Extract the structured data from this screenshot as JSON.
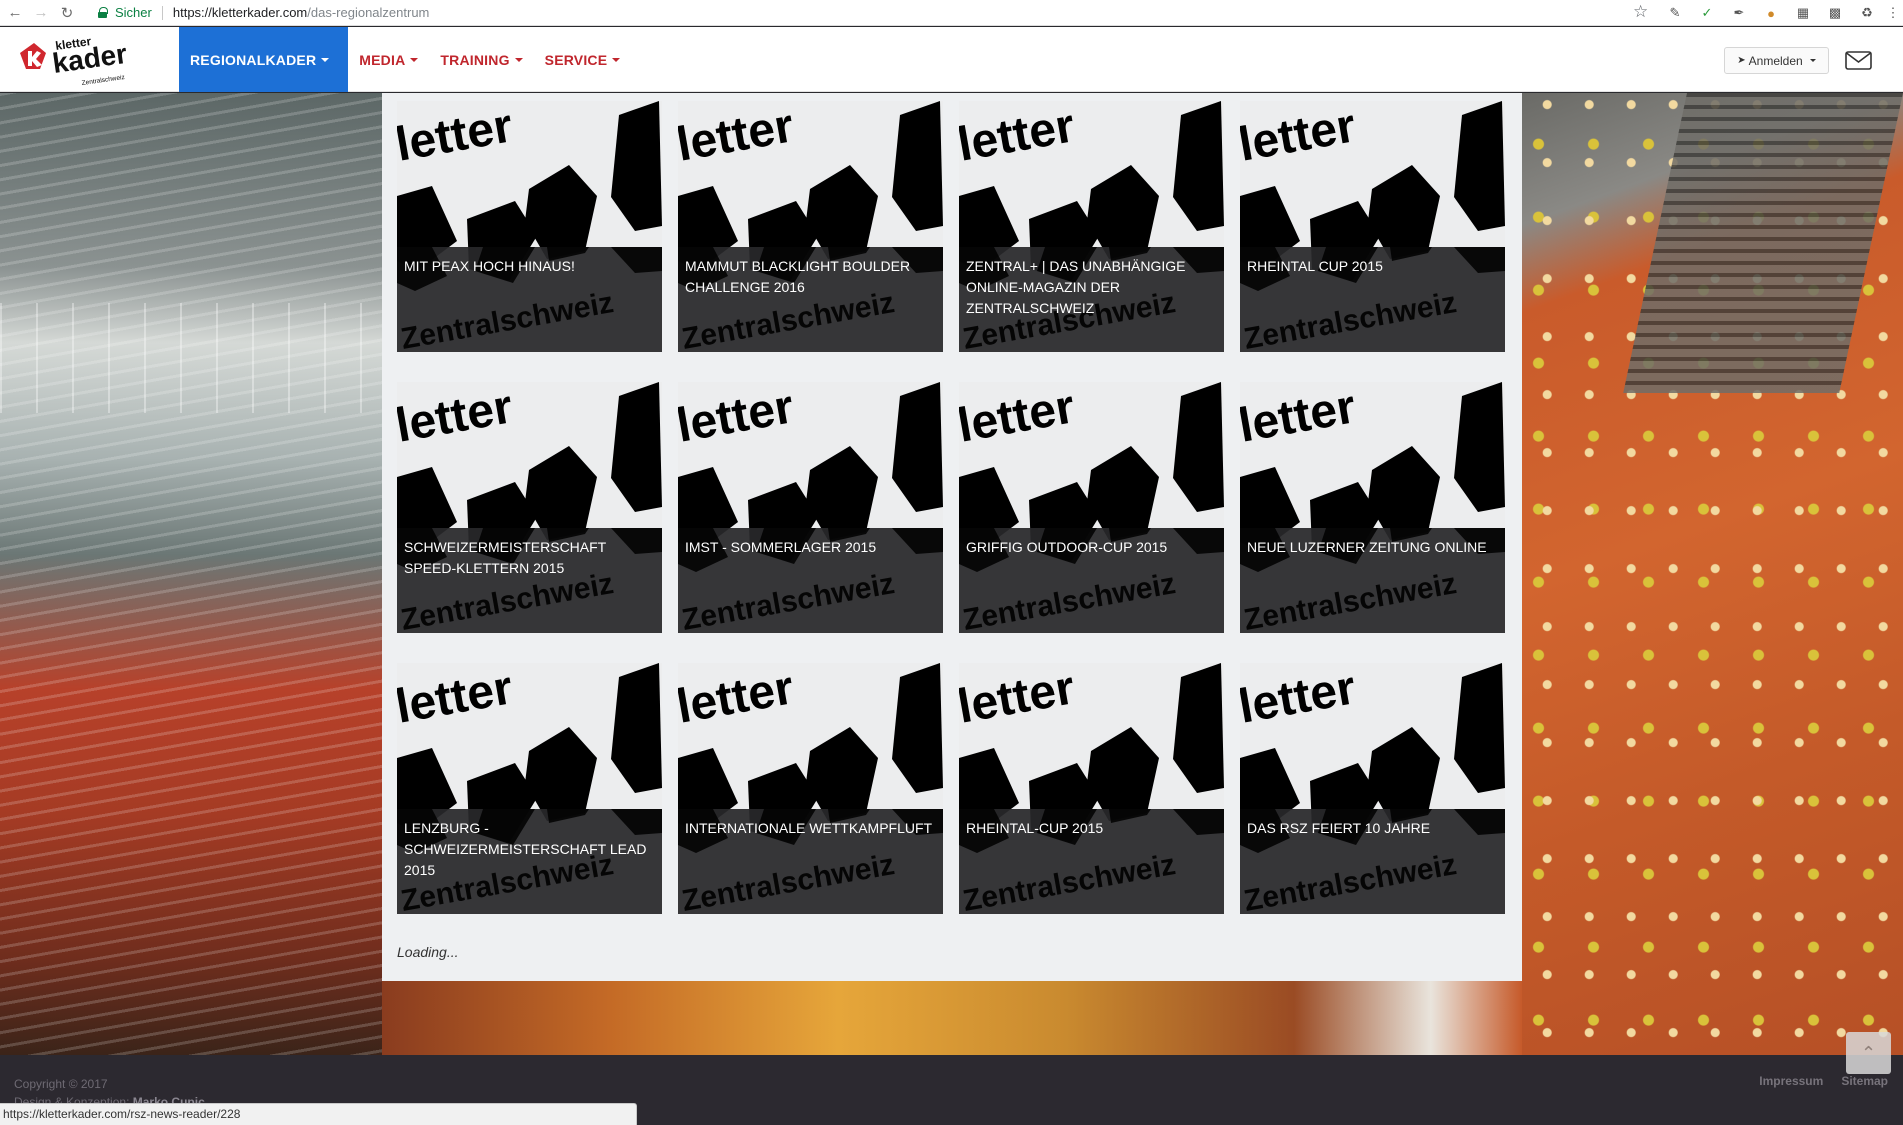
{
  "browser": {
    "secure_label": "Sicher",
    "url_host": "https://kletterkader.com",
    "url_path": "/das-regionalzentrum",
    "status_url": "https://kletterkader.com/rsz-news-reader/228"
  },
  "header": {
    "logo_alt": "kletter kader Zentralschweiz",
    "logo_lines": [
      "kletter",
      "kader",
      "Zentralschweiz"
    ],
    "nav": [
      {
        "label": "REGIONALKADER",
        "active": true
      },
      {
        "label": "MEDIA",
        "active": false
      },
      {
        "label": "TRAINING",
        "active": false
      },
      {
        "label": "SERVICE",
        "active": false
      }
    ],
    "login_label": "Anmelden",
    "accent_color": "#1d70d6",
    "nav_color": "#c0262d"
  },
  "cards": [
    {
      "title": "MIT PEAX HOCH HINAUS!"
    },
    {
      "title": "MAMMUT BLACKLIGHT BOULDER CHALLENGE 2016"
    },
    {
      "title": "ZENTRAL+ | DAS UNABHÄNGIGE ONLINE-MAGAZIN DER ZENTRALSCHWEIZ"
    },
    {
      "title": "RHEINTAL CUP 2015"
    },
    {
      "title": "SCHWEIZERMEISTERSCHAFT SPEED-KLETTERN 2015"
    },
    {
      "title": "IMST - SOMMERLAGER 2015"
    },
    {
      "title": "GRIFFIG OUTDOOR-CUP 2015"
    },
    {
      "title": "NEUE LUZERNER ZEITUNG ONLINE"
    },
    {
      "title": "LENZBURG - SCHWEIZERMEISTERSCHAFT LEAD 2015"
    },
    {
      "title": "INTERNATIONALE WETTKAMPFLUFT"
    },
    {
      "title": "RHEINTAL-CUP 2015"
    },
    {
      "title": "DAS RSZ FEIERT 10 JAHRE"
    }
  ],
  "card_art": {
    "line1": "letter",
    "line2": "Zentralschweiz"
  },
  "loading_text": "Loading...",
  "footer": {
    "copyright": "Copyright © 2017",
    "design_prefix": "Design & Konzeption:",
    "design_author": "Marko Cupic",
    "links": [
      "Impressum",
      "Sitemap"
    ]
  }
}
